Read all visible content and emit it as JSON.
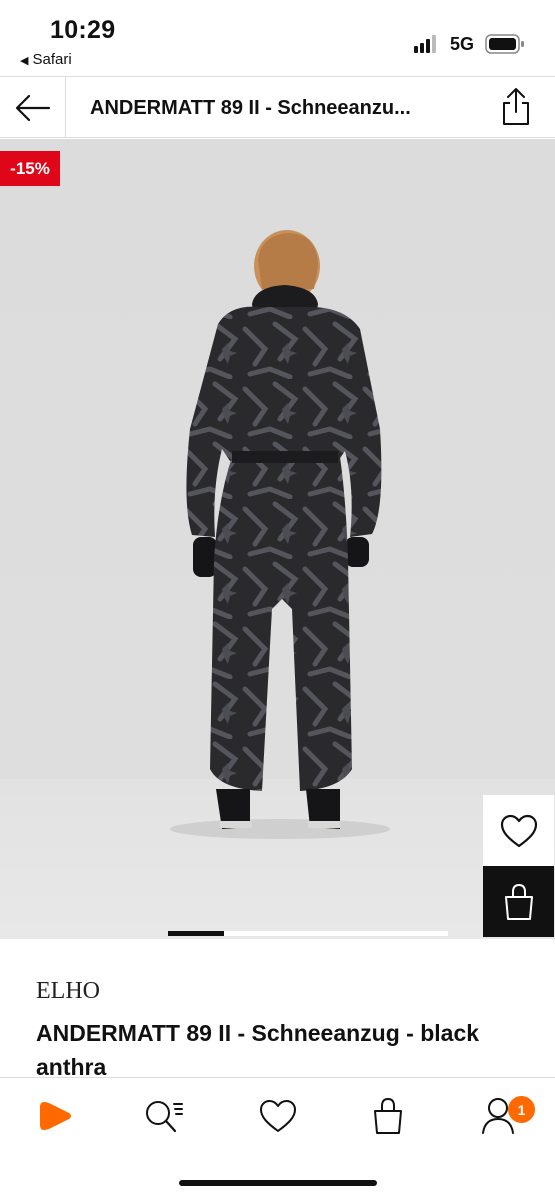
{
  "status_bar": {
    "time": "10:29",
    "back_app": "Safari",
    "network": "5G"
  },
  "nav": {
    "title": "ANDERMATT 89 II - Schneeanzu..."
  },
  "product": {
    "discount_badge": "-15%",
    "brand": "ELHO",
    "name": "ANDERMATT 89 II - Schneeanzug - black anthra",
    "image_pages": 5,
    "current_image": 1
  },
  "colors": {
    "accent": "#ff6900",
    "sale_red": "#e0061a",
    "text": "#111111"
  },
  "tabbar": {
    "items": [
      {
        "icon": "play-logo-icon"
      },
      {
        "icon": "search-list-icon"
      },
      {
        "icon": "heart-icon"
      },
      {
        "icon": "bag-icon"
      },
      {
        "icon": "profile-icon"
      }
    ],
    "badge_count": "1"
  }
}
